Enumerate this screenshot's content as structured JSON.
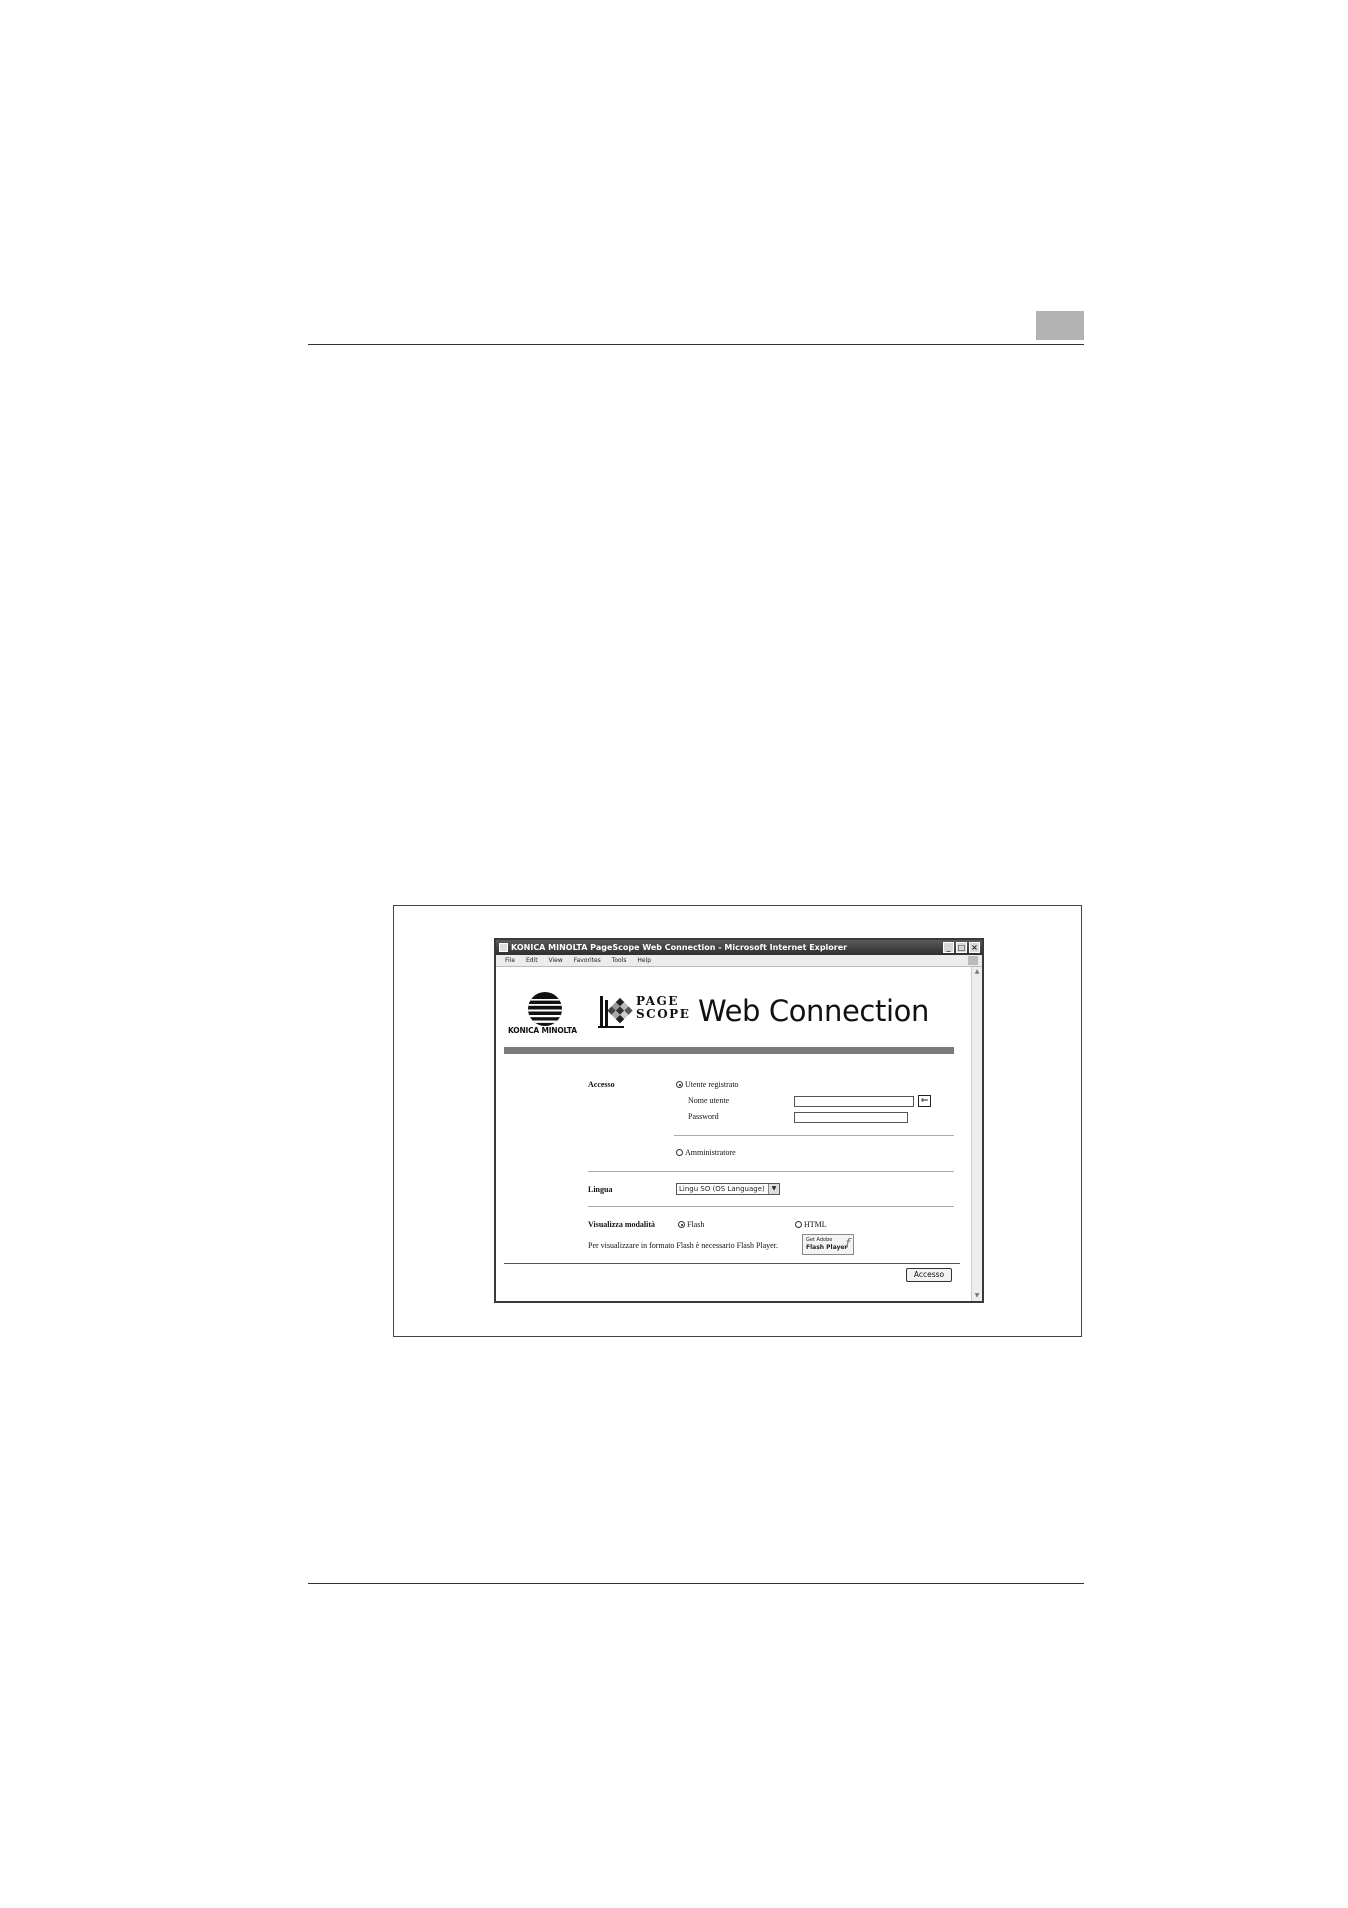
{
  "browser": {
    "title": "KONICA MINOLTA PageScope Web Connection - Microsoft Internet Explorer",
    "menu": [
      "File",
      "Edit",
      "View",
      "Favorites",
      "Tools",
      "Help"
    ]
  },
  "branding": {
    "company": "KONICA MINOLTA",
    "product_line1": "PAGE",
    "product_line2": "SCOPE",
    "product_title": "Web Connection"
  },
  "login_form": {
    "access_label": "Accesso",
    "registered_user_option": "Utente registrato",
    "registered_user_selected": true,
    "username_label": "Nome utente",
    "username_value": "",
    "password_label": "Password",
    "password_value": "",
    "administrator_option": "Amministratore",
    "administrator_selected": false,
    "language_label": "Lingua",
    "language_selected": "Lingu SO (OS Language)",
    "display_mode_label": "Visualizza modalità",
    "flash_option": "Flash",
    "flash_selected": true,
    "html_option": "HTML",
    "html_selected": false,
    "flash_note": "Per visualizzare in formato Flash è necessario Flash Player.",
    "flash_badge_line1": "Get Adobe",
    "flash_badge_line2": "Flash Player",
    "submit_label": "Accesso"
  }
}
